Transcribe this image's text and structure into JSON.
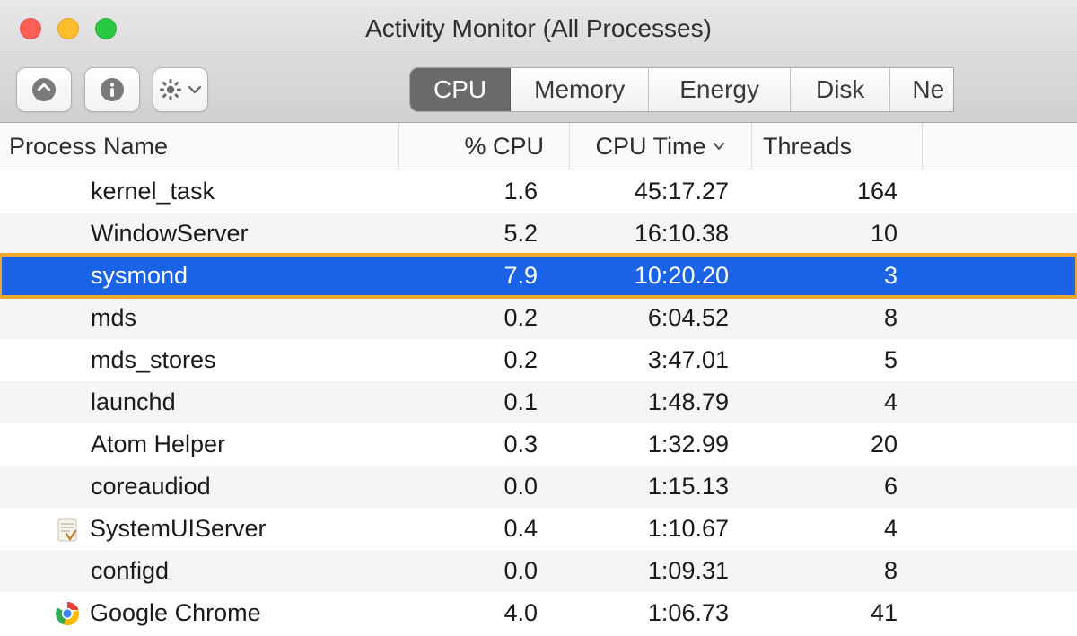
{
  "window": {
    "title": "Activity Monitor (All Processes)"
  },
  "toolbar": {
    "tabs": {
      "cpu": "CPU",
      "memory": "Memory",
      "energy": "Energy",
      "disk": "Disk",
      "network": "Ne"
    }
  },
  "columns": {
    "name": "Process Name",
    "cpu": "% CPU",
    "cputime": "CPU Time",
    "threads": "Threads"
  },
  "processes": [
    {
      "name": "kernel_task",
      "cpu": "1.6",
      "cputime": "45:17.27",
      "threads": "164",
      "icon": null,
      "selected": false
    },
    {
      "name": "WindowServer",
      "cpu": "5.2",
      "cputime": "16:10.38",
      "threads": "10",
      "icon": null,
      "selected": false
    },
    {
      "name": "sysmond",
      "cpu": "7.9",
      "cputime": "10:20.20",
      "threads": "3",
      "icon": null,
      "selected": true
    },
    {
      "name": "mds",
      "cpu": "0.2",
      "cputime": "6:04.52",
      "threads": "8",
      "icon": null,
      "selected": false
    },
    {
      "name": "mds_stores",
      "cpu": "0.2",
      "cputime": "3:47.01",
      "threads": "5",
      "icon": null,
      "selected": false
    },
    {
      "name": "launchd",
      "cpu": "0.1",
      "cputime": "1:48.79",
      "threads": "4",
      "icon": null,
      "selected": false
    },
    {
      "name": "Atom Helper",
      "cpu": "0.3",
      "cputime": "1:32.99",
      "threads": "20",
      "icon": null,
      "selected": false
    },
    {
      "name": "coreaudiod",
      "cpu": "0.0",
      "cputime": "1:15.13",
      "threads": "6",
      "icon": null,
      "selected": false
    },
    {
      "name": "SystemUIServer",
      "cpu": "0.4",
      "cputime": "1:10.67",
      "threads": "4",
      "icon": "systemui",
      "selected": false
    },
    {
      "name": "configd",
      "cpu": "0.0",
      "cputime": "1:09.31",
      "threads": "8",
      "icon": null,
      "selected": false
    },
    {
      "name": "Google Chrome",
      "cpu": "4.0",
      "cputime": "1:06.73",
      "threads": "41",
      "icon": "chrome",
      "selected": false
    }
  ]
}
